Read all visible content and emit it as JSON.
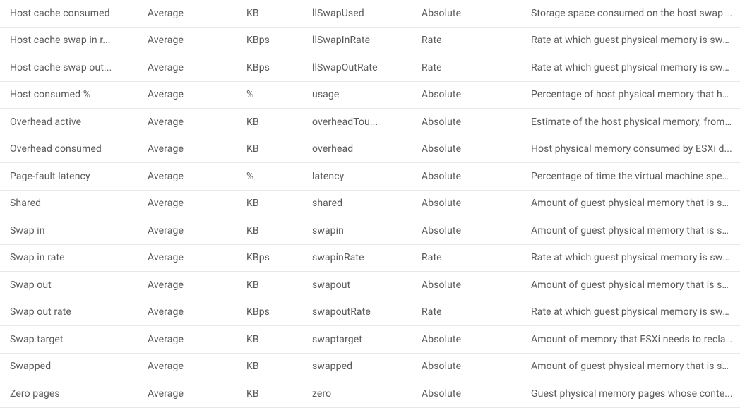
{
  "rows": [
    {
      "name": "Host cache consumed",
      "rollup": "Average",
      "unit": "KB",
      "internal": "llSwapUsed",
      "stats": "Absolute",
      "desc": "Storage space consumed on the host swap ..."
    },
    {
      "name": "Host cache swap in r...",
      "rollup": "Average",
      "unit": "KBps",
      "internal": "llSwapInRate",
      "stats": "Rate",
      "desc": "Rate at which guest physical memory is swa..."
    },
    {
      "name": "Host cache swap out...",
      "rollup": "Average",
      "unit": "KBps",
      "internal": "llSwapOutRate",
      "stats": "Rate",
      "desc": "Rate at which guest physical memory is swa..."
    },
    {
      "name": "Host consumed %",
      "rollup": "Average",
      "unit": "%",
      "internal": "usage",
      "stats": "Absolute",
      "desc": "Percentage of host physical memory that ha..."
    },
    {
      "name": "Overhead active",
      "rollup": "Average",
      "unit": "KB",
      "internal": "overheadTou...",
      "stats": "Absolute",
      "desc": "Estimate of the host physical memory, from ..."
    },
    {
      "name": "Overhead consumed",
      "rollup": "Average",
      "unit": "KB",
      "internal": "overhead",
      "stats": "Absolute",
      "desc": "Host physical memory consumed by ESXi d..."
    },
    {
      "name": "Page-fault latency",
      "rollup": "Average",
      "unit": "%",
      "internal": "latency",
      "stats": "Absolute",
      "desc": "Percentage of time the virtual machine spen..."
    },
    {
      "name": "Shared",
      "rollup": "Average",
      "unit": "KB",
      "internal": "shared",
      "stats": "Absolute",
      "desc": "Amount of guest physical memory that is sh..."
    },
    {
      "name": "Swap in",
      "rollup": "Average",
      "unit": "KB",
      "internal": "swapin",
      "stats": "Absolute",
      "desc": "Amount of guest physical memory that is sw..."
    },
    {
      "name": "Swap in rate",
      "rollup": "Average",
      "unit": "KBps",
      "internal": "swapinRate",
      "stats": "Rate",
      "desc": "Rate at which guest physical memory is swa..."
    },
    {
      "name": "Swap out",
      "rollup": "Average",
      "unit": "KB",
      "internal": "swapout",
      "stats": "Absolute",
      "desc": "Amount of guest physical memory that is sw..."
    },
    {
      "name": "Swap out rate",
      "rollup": "Average",
      "unit": "KBps",
      "internal": "swapoutRate",
      "stats": "Rate",
      "desc": "Rate at which guest physical memory is swa..."
    },
    {
      "name": "Swap target",
      "rollup": "Average",
      "unit": "KB",
      "internal": "swaptarget",
      "stats": "Absolute",
      "desc": "Amount of memory that ESXi needs to reclai..."
    },
    {
      "name": "Swapped",
      "rollup": "Average",
      "unit": "KB",
      "internal": "swapped",
      "stats": "Absolute",
      "desc": "Amount of guest physical memory that is sw..."
    },
    {
      "name": "Zero pages",
      "rollup": "Average",
      "unit": "KB",
      "internal": "zero",
      "stats": "Absolute",
      "desc": "Guest physical memory pages whose conte..."
    }
  ]
}
